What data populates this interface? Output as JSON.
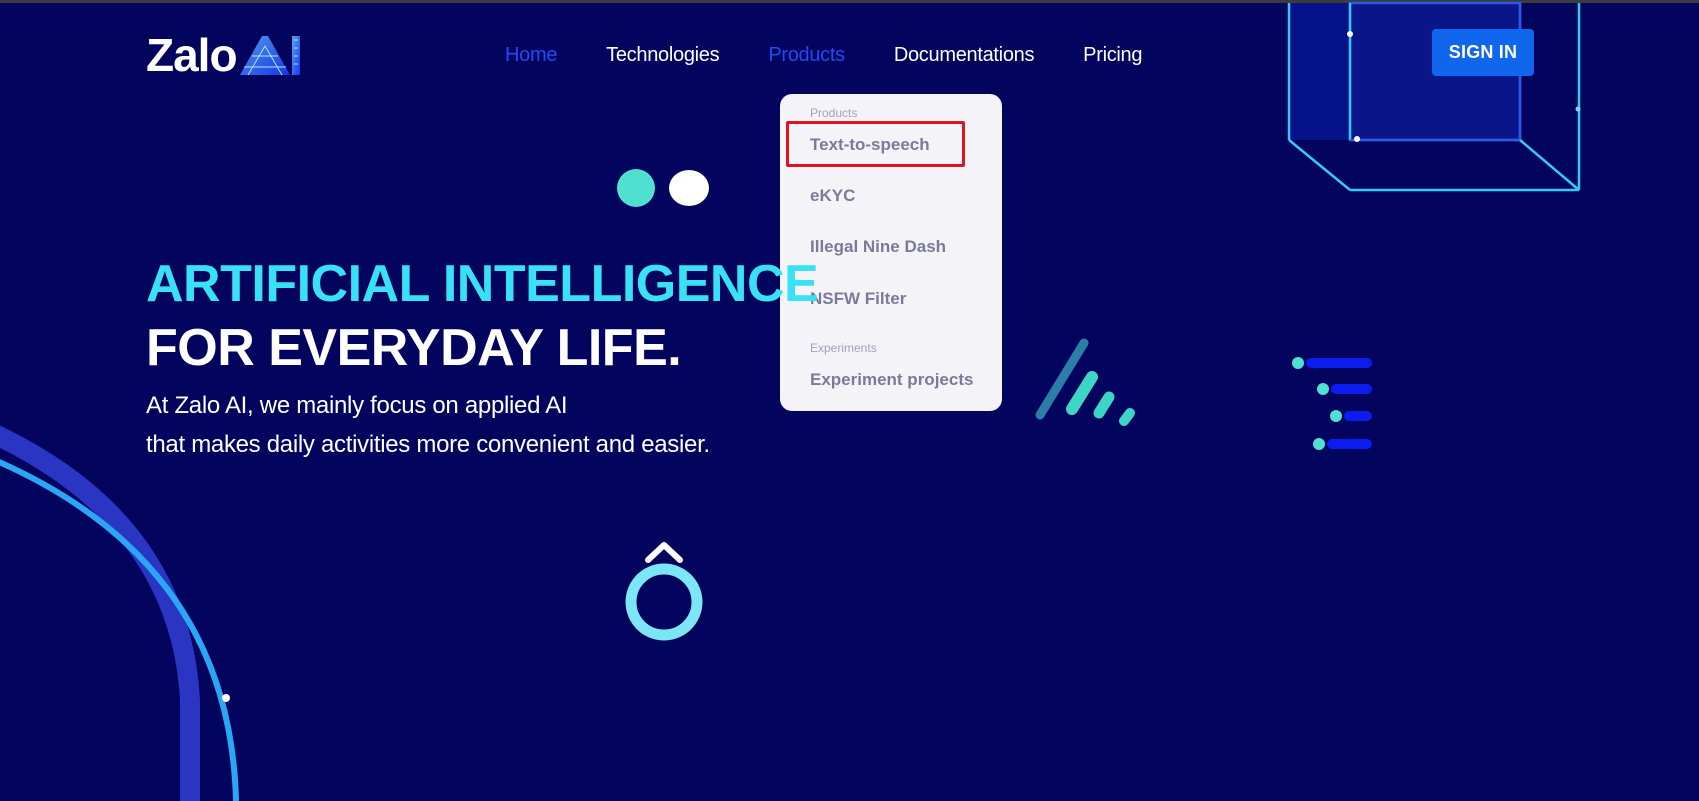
{
  "header": {
    "logo": {
      "text": "Zalo",
      "accent_text": "AI"
    },
    "nav": [
      {
        "label": "Home",
        "active": true
      },
      {
        "label": "Technologies",
        "active": false
      },
      {
        "label": "Products",
        "active": true
      },
      {
        "label": "Documentations",
        "active": false
      },
      {
        "label": "Pricing",
        "active": false
      }
    ],
    "signin_label": "SIGN IN"
  },
  "products_menu": {
    "sections": [
      {
        "label": "Products",
        "items": [
          "Text-to-speech",
          "eKYC",
          "Illegal Nine Dash",
          "NSFW Filter"
        ]
      },
      {
        "label": "Experiments",
        "items": [
          "Experiment projects"
        ]
      }
    ],
    "highlighted_item": "Text-to-speech"
  },
  "hero": {
    "title_line1": "ARTIFICIAL INTELLIGENCE",
    "title_line2": "FOR EVERYDAY LIFE.",
    "description_line1": "At Zalo AI, we mainly focus on applied AI",
    "description_line2": "that makes daily activities more convenient and easier."
  },
  "decorations": {
    "glyph": "Ô"
  },
  "colors": {
    "background": "#02045e",
    "accent_cyan": "#38e1f5",
    "nav_active": "#1f4cf0",
    "signin_bg": "#1166ee",
    "highlight_border": "#e0141e"
  }
}
